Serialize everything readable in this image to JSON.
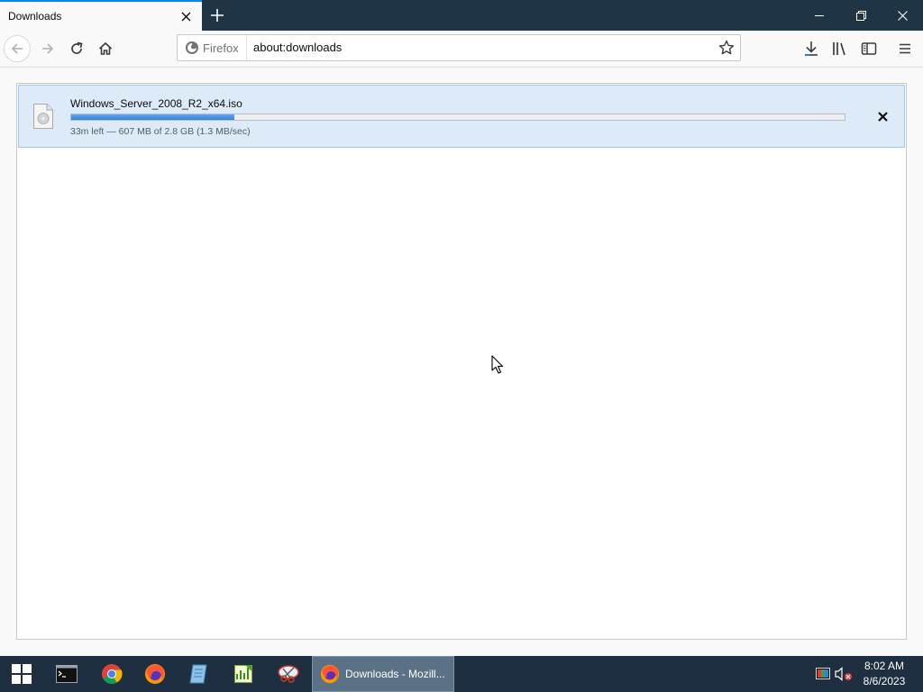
{
  "window": {
    "tab_title": "Downloads",
    "new_tab_icon": "plus-icon",
    "controls": [
      "minimize",
      "restore",
      "close"
    ]
  },
  "navbar": {
    "identity_label": "Firefox",
    "url": "about:downloads"
  },
  "download": {
    "file_name": "Windows_Server_2008_R2_x64.iso",
    "progress_fraction": 0.211,
    "status": "33m left — 607 MB of 2.8 GB (1.3 MB/sec)"
  },
  "taskbar": {
    "pinned": [
      "cmd-icon",
      "chrome-icon",
      "firefox-icon",
      "notepad-icon",
      "spreadsheet-icon",
      "snipping-icon"
    ],
    "active_task_label": "Downloads - Mozill...",
    "clock_time": "8:02 AM",
    "clock_date": "8/6/2023"
  },
  "colors": {
    "accent": "#0a84ff",
    "titlebar": "#1f3445",
    "taskbar": "#1d2f40",
    "download_row": "#ddeaf8",
    "progress": "#3a8ee6"
  }
}
